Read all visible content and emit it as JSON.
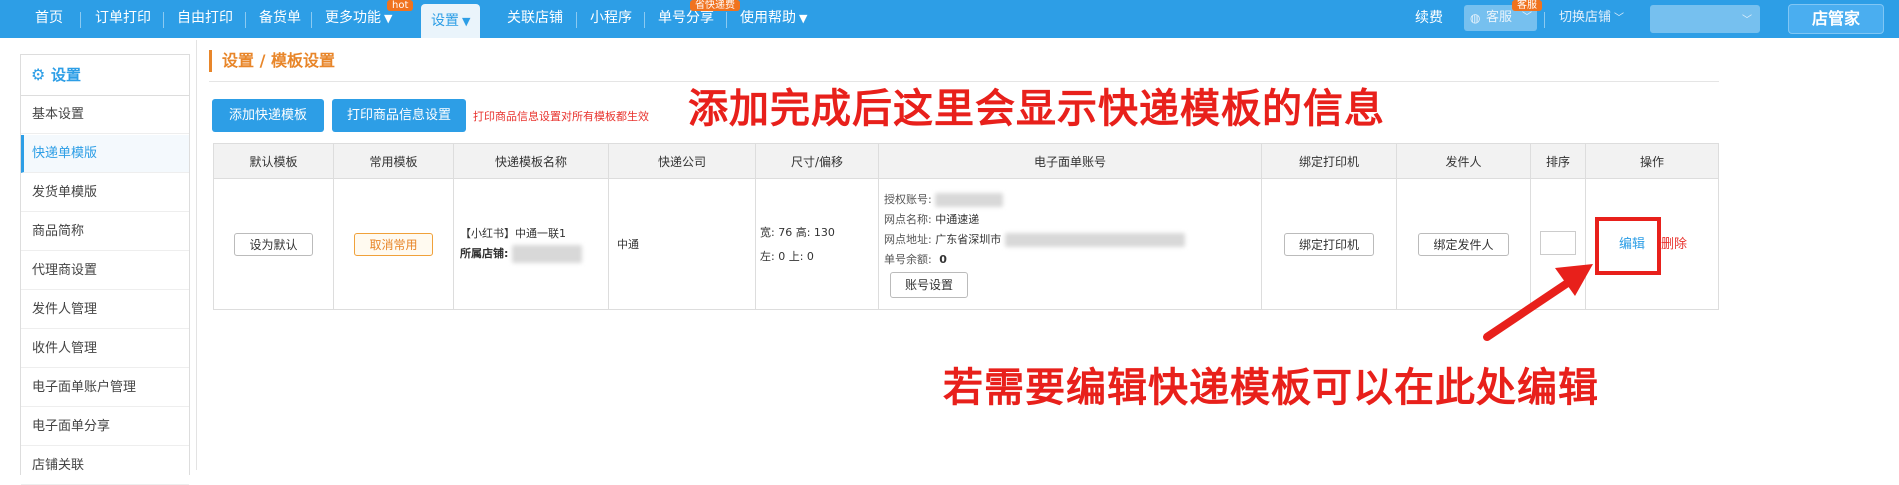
{
  "nav": {
    "items": [
      {
        "label": "首页"
      },
      {
        "label": "订单打印"
      },
      {
        "label": "自由打印"
      },
      {
        "label": "备货单"
      },
      {
        "label": "更多功能"
      },
      {
        "label": "设置"
      },
      {
        "label": "关联店铺"
      },
      {
        "label": "小程序"
      },
      {
        "label": "单号分享"
      },
      {
        "label": "使用帮助"
      }
    ],
    "hot_badge": "hot",
    "share_badge": "省快递费",
    "renew": "续费",
    "kefu": "客服",
    "kefu_badge": "客服",
    "switch_shop": "切换店铺",
    "logo": "店管家"
  },
  "sidebar": {
    "title": "设置",
    "items": [
      {
        "label": "基本设置"
      },
      {
        "label": "快递单模版"
      },
      {
        "label": "发货单模版"
      },
      {
        "label": "商品简称"
      },
      {
        "label": "代理商设置"
      },
      {
        "label": "发件人管理"
      },
      {
        "label": "收件人管理"
      },
      {
        "label": "电子面单账户管理"
      },
      {
        "label": "电子面单分享"
      },
      {
        "label": "店铺关联"
      }
    ],
    "active_index": 1
  },
  "breadcrumb": {
    "parent": "设置",
    "sep": "/",
    "current": "模板设置"
  },
  "toolbar": {
    "add_label": "添加快递模板",
    "print_info_label": "打印商品信息设置",
    "notice": "打印商品信息设置对所有模板都生效"
  },
  "annotations": {
    "top": "添加完成后这里会显示快递模板的信息",
    "bottom": "若需要编辑快递模板可以在此处编辑"
  },
  "table": {
    "headers": [
      "默认模板",
      "常用模板",
      "快递模板名称",
      "快递公司",
      "尺寸/偏移",
      "电子面单账号",
      "绑定打印机",
      "发件人",
      "排序",
      "操作"
    ],
    "row": {
      "set_default": "设为默认",
      "cancel_common": "取消常用",
      "template_name": "【小红书】中通一联1",
      "shop_label": "所属店铺:",
      "company": "中通",
      "size_line1": "宽: 76 高: 130",
      "size_line2": "左: 0 上: 0",
      "auth_account_label": "授权账号:",
      "branch_name_label": "网点名称:",
      "branch_name": "中通速递",
      "branch_addr_label": "网点地址:",
      "branch_addr": "广东省深圳市",
      "balance_label": "单号余额:",
      "balance": "0",
      "account_settings": "账号设置",
      "bind_printer": "绑定打印机",
      "bind_sender": "绑定发件人",
      "edit": "编辑",
      "delete": "删除"
    }
  },
  "colors": {
    "topbar": "#2d9ee6",
    "accent_orange": "#e8862a",
    "annotation_red": "#e8201b"
  }
}
